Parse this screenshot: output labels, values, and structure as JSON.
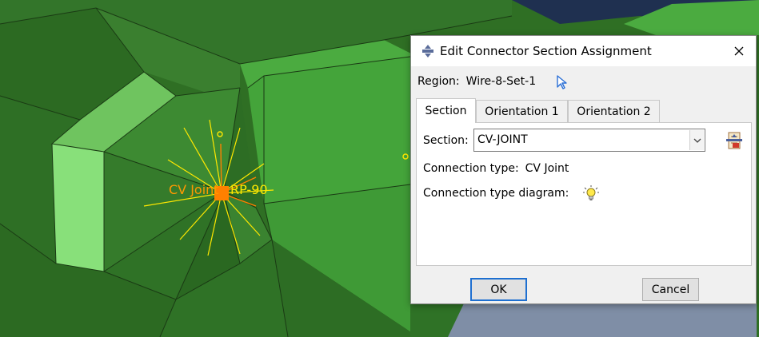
{
  "dialog": {
    "title": "Edit Connector Section Assignment",
    "region_label": "Region:",
    "region_value": "Wire-8-Set-1",
    "tabs": [
      {
        "label": "Section",
        "active": true
      },
      {
        "label": "Orientation 1",
        "active": false
      },
      {
        "label": "Orientation 2",
        "active": false
      }
    ],
    "section_label": "Section:",
    "section_value": "CV-JOINT",
    "connection_type_label": "Connection type:",
    "connection_type_value": "CV Joint",
    "connection_diagram_label": "Connection type diagram:",
    "ok_label": "OK",
    "cancel_label": "Cancel"
  },
  "viewport": {
    "connector_label": "CV Joint",
    "ref_point_label": "RP-90"
  },
  "colors": {
    "mesh_dark": "#2f6f24",
    "mesh_mid": "#3f8f34",
    "mesh_light": "#88e07a",
    "background_navy": "#1f3050",
    "connector_orange": "#ff8000",
    "wire_yellow": "#ffe800",
    "ok_border": "#1e6fd0"
  },
  "icons": {
    "title": "connector-section-icon",
    "pick": "cursor-arrow-icon",
    "manager": "section-manager-icon",
    "diagram": "lightbulb-icon",
    "close": "close-icon",
    "dropdown": "chevron-down-icon"
  }
}
